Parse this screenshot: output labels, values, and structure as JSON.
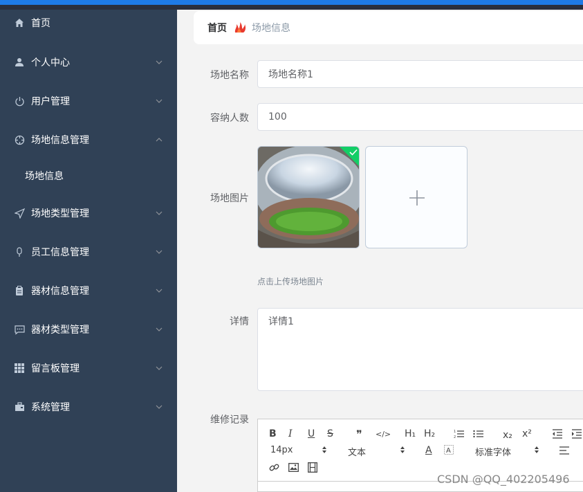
{
  "sidebar": {
    "items": [
      {
        "label": "首页",
        "icon": "home-icon"
      },
      {
        "label": "个人中心",
        "icon": "user-icon"
      },
      {
        "label": "用户管理",
        "icon": "power-icon"
      },
      {
        "label": "场地信息管理",
        "icon": "crosshair-icon"
      },
      {
        "label": "场地信息"
      },
      {
        "label": "场地类型管理",
        "icon": "send-icon"
      },
      {
        "label": "员工信息管理",
        "icon": "mic-icon"
      },
      {
        "label": "器材信息管理",
        "icon": "clipboard-icon"
      },
      {
        "label": "器材类型管理",
        "icon": "chat-icon"
      },
      {
        "label": "留言板管理",
        "icon": "grid-icon"
      },
      {
        "label": "系统管理",
        "icon": "briefcase-icon"
      }
    ]
  },
  "breadcrumb": {
    "home": "首页",
    "current": "场地信息"
  },
  "form": {
    "name_label": "场地名称",
    "name_value": "场地名称1",
    "capacity_label": "容纳人数",
    "capacity_value": "100",
    "image_label": "场地图片",
    "image_hint": "点击上传场地图片",
    "detail_label": "详情",
    "detail_value": "详情1",
    "repair_label": "维修记录"
  },
  "editor": {
    "font_size": "14px",
    "paragraph": "文本",
    "font_family": "标准字体",
    "bold": "B",
    "italic": "I",
    "underline": "U",
    "strike": "S",
    "quote": "❞",
    "code": "</>",
    "h1": "H₁",
    "h2": "H₂",
    "sub": "x₂",
    "sup": "x²",
    "font_color": "A"
  },
  "watermark": "CSDN @QQ_402205496",
  "colors": {
    "sidebar_bg": "#304156",
    "accent": "#1e7ae6",
    "success": "#13ce66"
  }
}
